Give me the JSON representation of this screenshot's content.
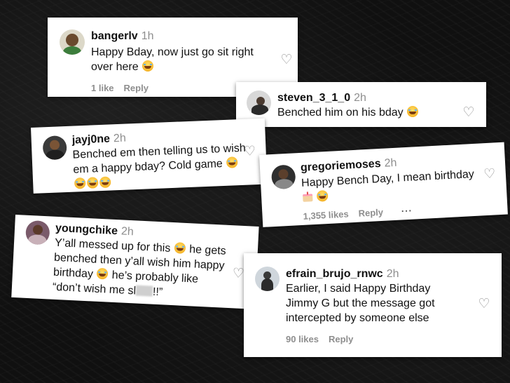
{
  "comments": [
    {
      "user": "bangerlv",
      "time": "1h",
      "lines": [
        "Happy Bday, now just go sit right",
        "over here"
      ],
      "likes": "1 like",
      "reply": "Reply"
    },
    {
      "user": "steven_3_1_0",
      "time": "2h",
      "lines": [
        "Benched him on his bday"
      ]
    },
    {
      "user": "jayj0ne",
      "time": "2h",
      "lines": [
        "Benched em then telling us to wish",
        "em a happy bday? Cold game"
      ]
    },
    {
      "user": "gregoriemoses",
      "time": "2h",
      "lines": [
        "Happy Bench Day, I mean birthday"
      ],
      "likes": "1,355 likes",
      "reply": "Reply",
      "more": "···"
    },
    {
      "user": "youngchike",
      "time": "2h",
      "lines": [
        "Y’all messed up for this",
        "he gets",
        "benched then y’all wish him happy",
        "birthday",
        "he’s probably like",
        "“don’t wish me sl",
        "!!”"
      ]
    },
    {
      "user": "efrain_brujo_rnwc",
      "time": "2h",
      "lines": [
        "Earlier, I said Happy Birthday",
        "Jimmy G but the message got",
        "intercepted by someone else"
      ],
      "likes": "90 likes",
      "reply": "Reply"
    }
  ],
  "icons": {
    "like": "heart-outline-icon",
    "emoji_laugh": "tears-of-joy-emoji",
    "emoji_cake": "birthday-cake-emoji"
  },
  "colors": {
    "card": "#ffffff",
    "muted": "#8e8e8e",
    "background": "#101010"
  }
}
